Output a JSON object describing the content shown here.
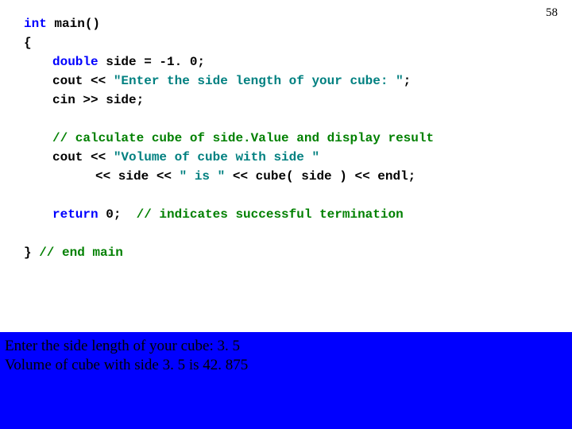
{
  "page_number": "58",
  "code": {
    "l1_a": "int",
    "l1_b": " main()",
    "l2": "{",
    "l3_a": "double",
    "l3_b": " side = -1. 0;",
    "l4_a": "cout << ",
    "l4_b": "\"Enter the side length of your cube: \"",
    "l4_c": ";",
    "l5": "cin >> side;",
    "l6_a": "// calculate cube of side.Value and display result",
    "l7_a": "cout << ",
    "l7_b": "\"Volume of cube with side \"",
    "l8_a": "<< side << ",
    "l8_b": "\" is \"",
    "l8_c": " << cube( side ) << endl;",
    "l9_a": "return",
    "l9_b": " 0;  ",
    "l9_c": "// indicates successful termination",
    "l10_a": "} ",
    "l10_b": "// end main"
  },
  "output": {
    "line1": "Enter the side length of your cube: 3. 5",
    "line2": "Volume of cube with side 3. 5 is 42. 875"
  }
}
